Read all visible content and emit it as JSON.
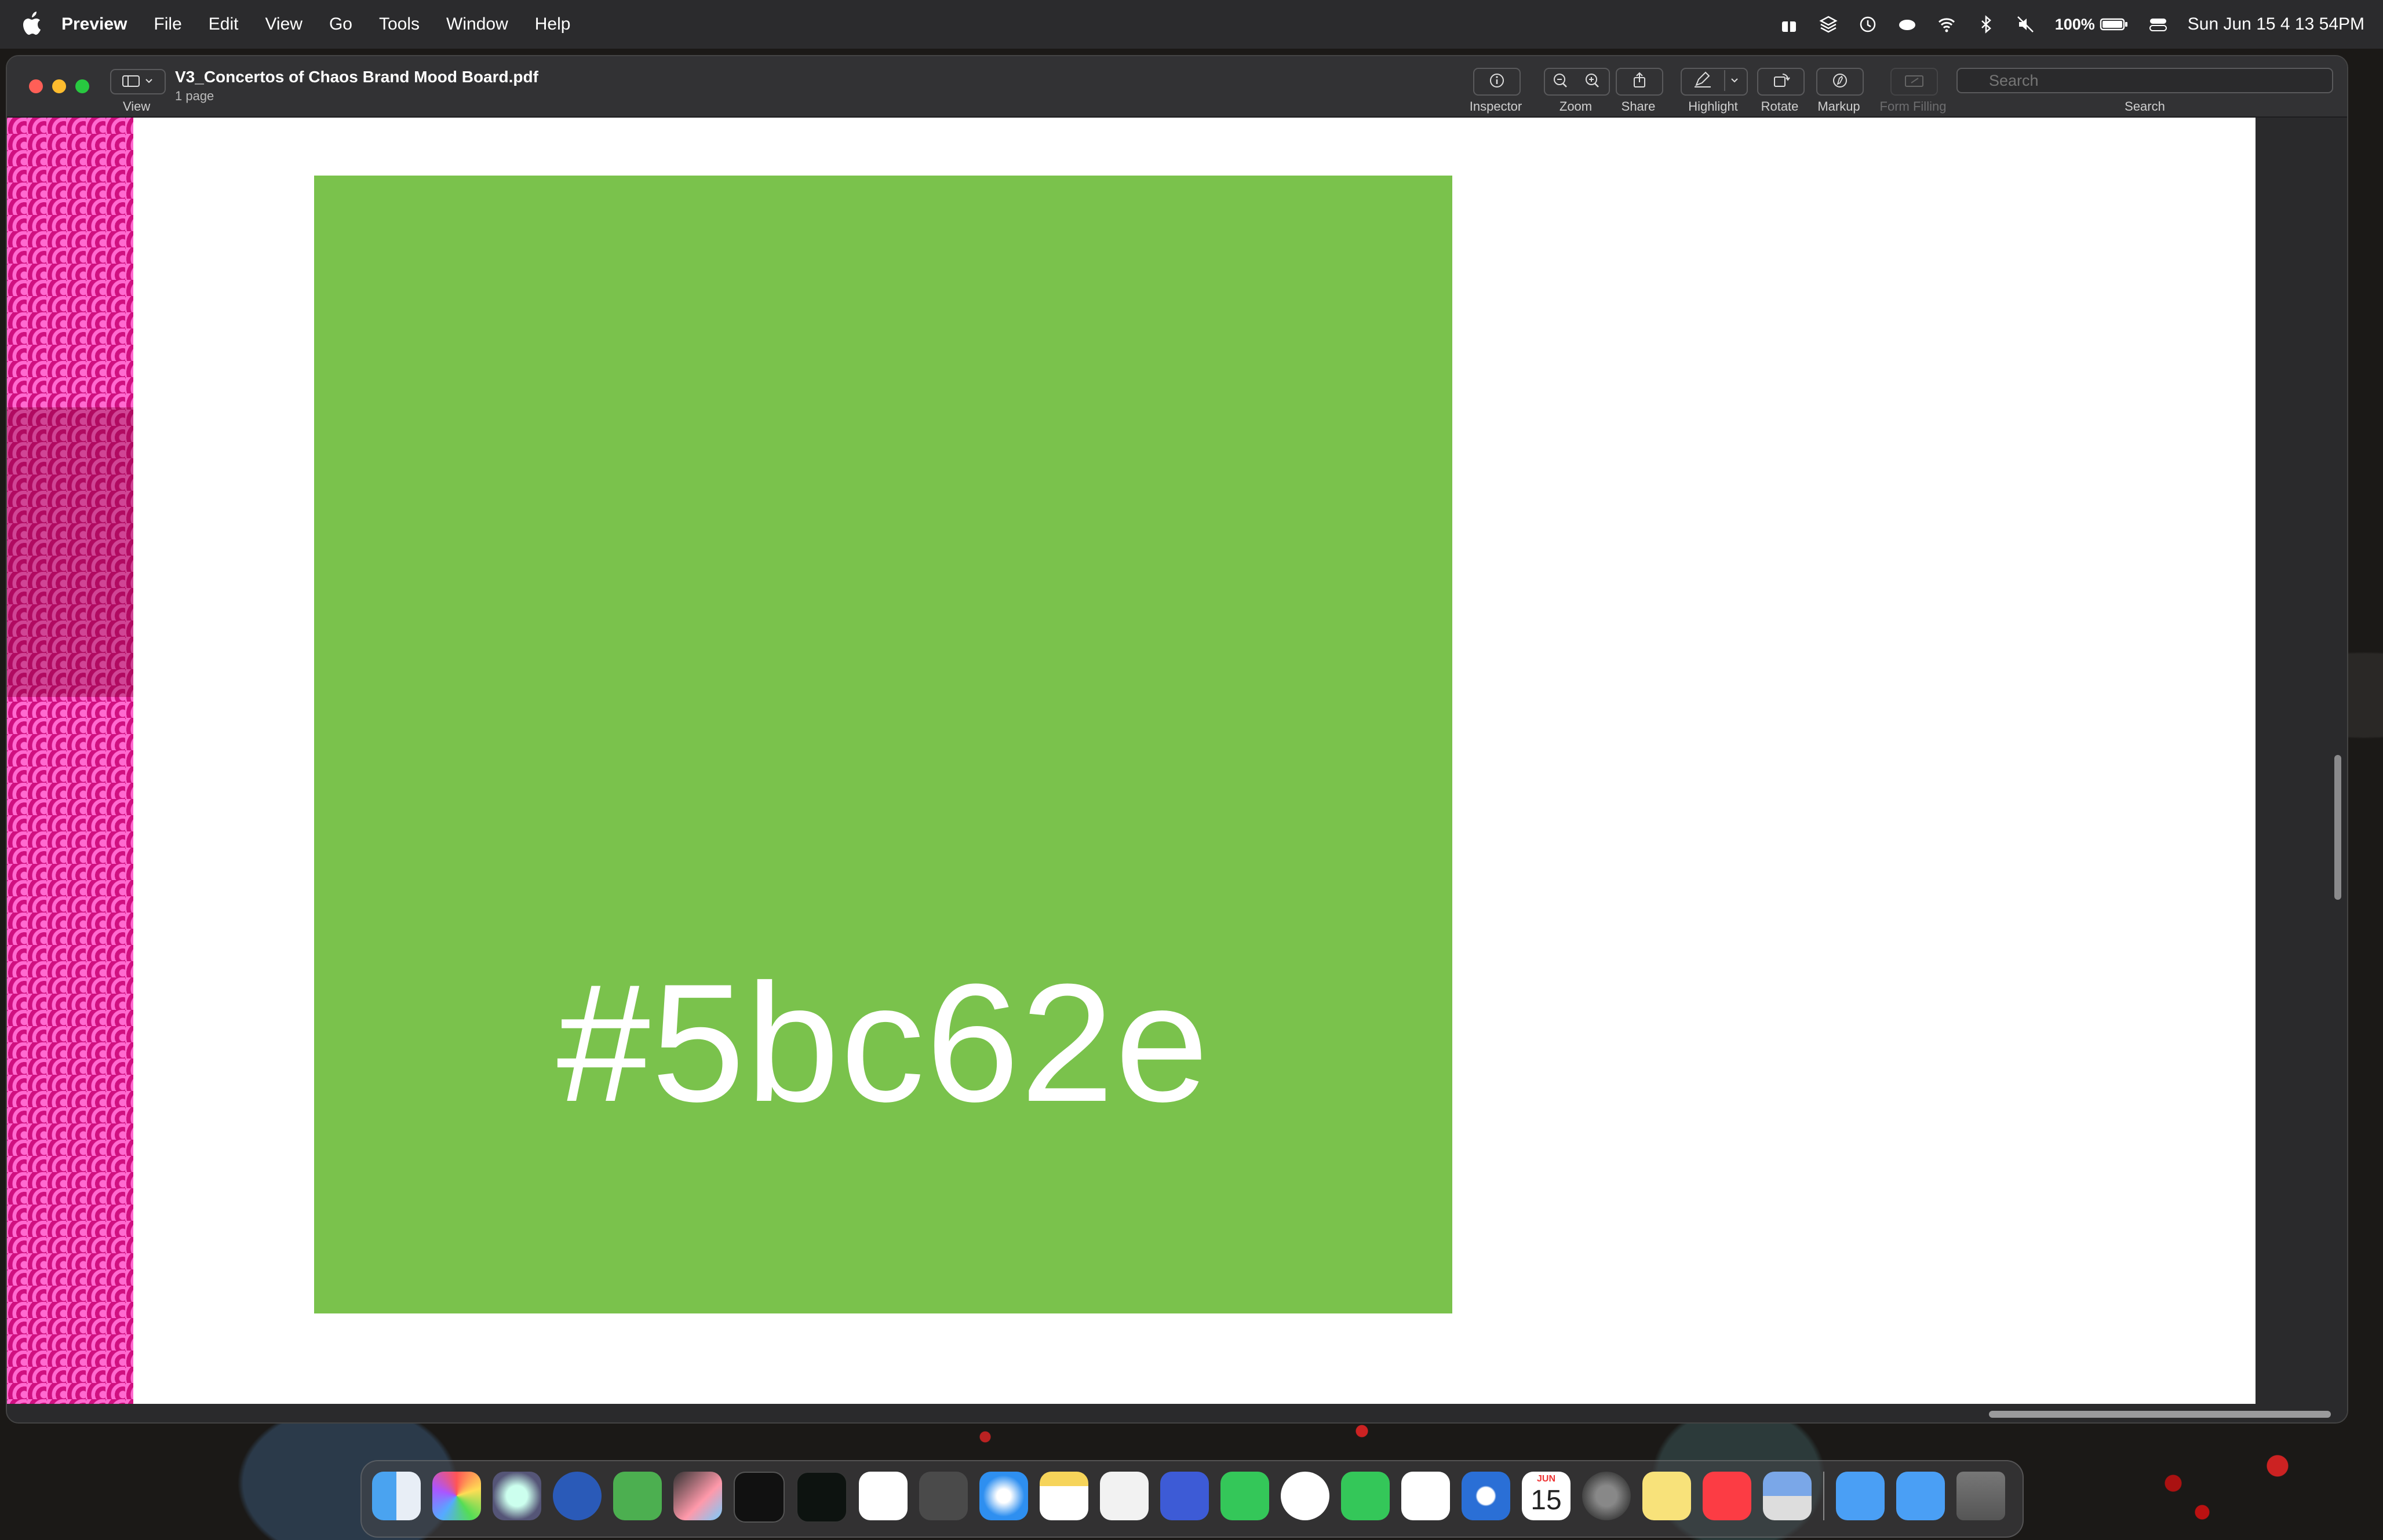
{
  "menubar": {
    "app_name": "Preview",
    "items": [
      "File",
      "Edit",
      "View",
      "Go",
      "Tools",
      "Window",
      "Help"
    ],
    "battery": "100%",
    "clock": "Sun Jun 15  4 13 54PM"
  },
  "window": {
    "title": "V3_Concertos of Chaos Brand Mood Board.pdf",
    "subtitle": "1 page",
    "view_label": "View",
    "toolbar": {
      "inspector": "Inspector",
      "zoom": "Zoom",
      "share": "Share",
      "highlight": "Highlight",
      "rotate": "Rotate",
      "markup": "Markup",
      "form_filling": "Form Filling",
      "search": "Search"
    },
    "search_placeholder": "Search"
  },
  "document": {
    "swatch_color": "#7ac24c",
    "hex_label": "#5bc62e"
  },
  "dock": {
    "icons": [
      "finder-icon",
      "launchpad-icon",
      "quicktime-icon",
      "oscar-icon",
      "o2-icon",
      "final-cut-icon",
      "terminal-icon",
      "terminal-dark-icon",
      "vscode-icon",
      "sublime-icon",
      "safari-icon",
      "notes-icon",
      "preview-icon",
      "screens-icon",
      "facetime-icon",
      "messenger-icon",
      "messages-icon",
      "slack-icon",
      "browser-icon",
      "calendar-icon",
      "system-settings-icon",
      "stickies-icon",
      "music-icon",
      "preview-app-icon",
      "applications-folder-icon",
      "downloads-folder-icon",
      "trash-icon"
    ],
    "calendar_month": "JUN",
    "calendar_day": "15"
  }
}
